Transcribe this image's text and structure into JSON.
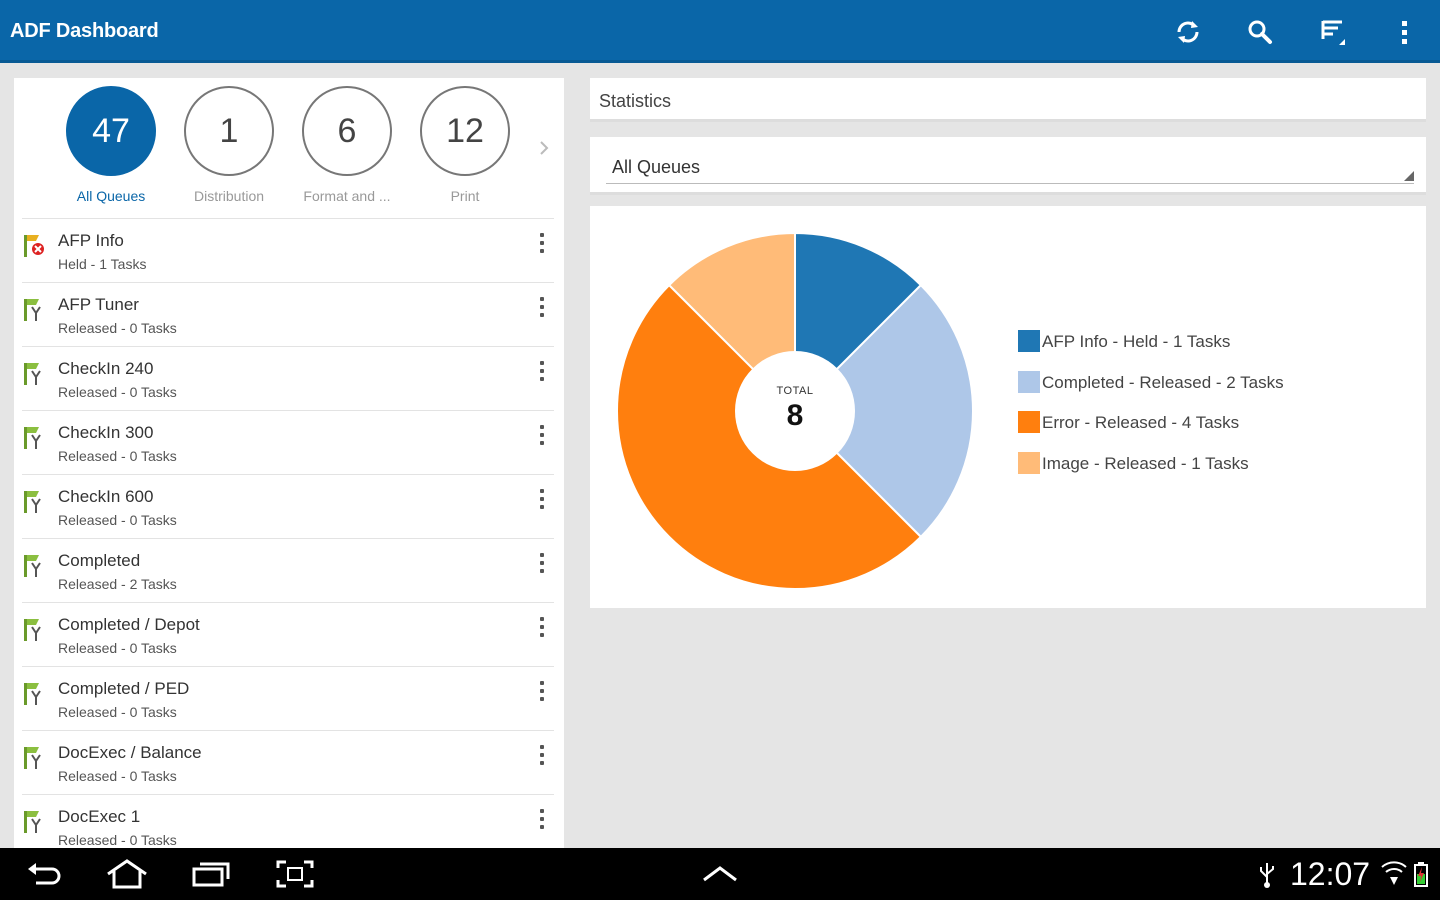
{
  "app": {
    "title": "ADF Dashboard",
    "accent": "#0a66a8",
    "actions": [
      "refresh-icon",
      "search-icon",
      "filter-sort-icon",
      "overflow-menu-icon"
    ]
  },
  "queue_tabs": [
    {
      "count": "47",
      "label": "All Queues",
      "active": true
    },
    {
      "count": "1",
      "label": "Distribution",
      "active": false
    },
    {
      "count": "6",
      "label": "Format and ...",
      "active": false
    },
    {
      "count": "12",
      "label": "Print",
      "active": false
    }
  ],
  "queues": [
    {
      "name": "AFP Info",
      "status": "Held - 1 Tasks",
      "icon": "held-queue-icon"
    },
    {
      "name": "AFP Tuner",
      "status": "Released - 0 Tasks",
      "icon": "released-queue-icon"
    },
    {
      "name": "CheckIn 240",
      "status": "Released - 0 Tasks",
      "icon": "released-queue-icon"
    },
    {
      "name": "CheckIn 300",
      "status": "Released - 0 Tasks",
      "icon": "released-queue-icon"
    },
    {
      "name": "CheckIn 600",
      "status": "Released - 0 Tasks",
      "icon": "released-queue-icon"
    },
    {
      "name": "Completed",
      "status": "Released - 2 Tasks",
      "icon": "released-queue-icon"
    },
    {
      "name": "Completed / Depot",
      "status": "Released - 0 Tasks",
      "icon": "released-queue-icon"
    },
    {
      "name": "Completed / PED",
      "status": "Released - 0 Tasks",
      "icon": "released-queue-icon"
    },
    {
      "name": "DocExec / Balance",
      "status": "Released - 0 Tasks",
      "icon": "released-queue-icon"
    },
    {
      "name": "DocExec 1",
      "status": "Released - 0 Tasks",
      "icon": "released-queue-icon"
    }
  ],
  "statistics": {
    "header": "Statistics",
    "queue_select": "All Queues",
    "total_label": "TOTAL",
    "total_value": "8"
  },
  "chart_data": {
    "type": "pie",
    "donut": true,
    "categories": [
      "AFP Info - Held - 1 Tasks",
      "Completed - Released - 2 Tasks",
      "Error - Released - 4 Tasks",
      "Image - Released - 1 Tasks"
    ],
    "values": [
      1,
      2,
      4,
      1
    ],
    "colors": [
      "#1f77b4",
      "#aec7e8",
      "#ff7f0e",
      "#ffbb78"
    ],
    "legend_position": "right"
  },
  "system_bar": {
    "time": "12:07",
    "nav": [
      "back-icon",
      "home-icon",
      "recent-apps-icon",
      "screenshot-icon"
    ],
    "center": "chevron-up-icon",
    "status": [
      "usb-icon",
      "wifi-icon",
      "battery-icon"
    ]
  }
}
